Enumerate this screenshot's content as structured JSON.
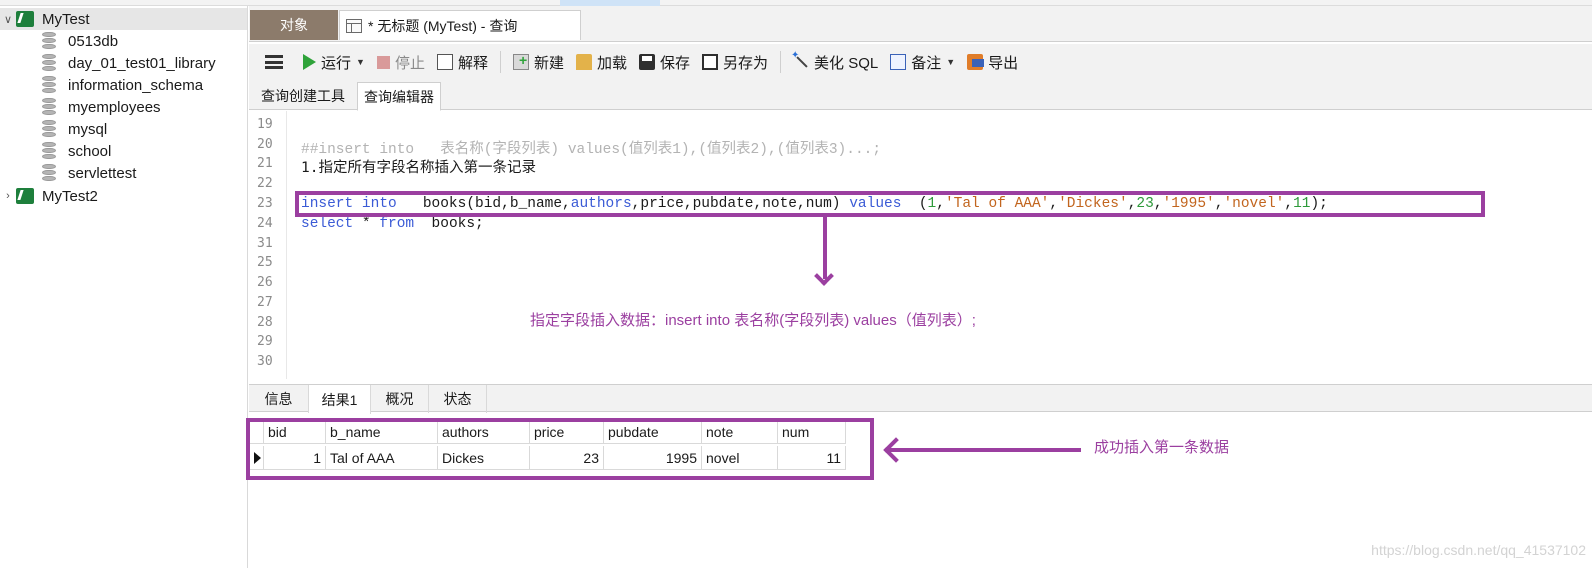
{
  "nav": {
    "connections": [
      {
        "name": "MyTest",
        "expanded": true,
        "databases": [
          "0513db",
          "day_01_test01_library",
          "information_schema",
          "myemployees",
          "mysql",
          "school",
          "servlettest"
        ]
      },
      {
        "name": "MyTest2",
        "expanded": false,
        "databases": []
      }
    ]
  },
  "tabs": {
    "objects": "对象",
    "query": "* 无标题 (MyTest) - 查询"
  },
  "toolbar": {
    "run": "运行",
    "stop": "停止",
    "explain": "解释",
    "new": "新建",
    "load": "加载",
    "save": "保存",
    "save_as": "另存为",
    "beautify": "美化 SQL",
    "note": "备注",
    "export": "导出"
  },
  "subtabs": {
    "builder": "查询创建工具",
    "editor": "查询编辑器"
  },
  "editor": {
    "line_numbers": [
      "19",
      "20",
      "21",
      "22",
      "23",
      "24",
      "25",
      "26",
      "27",
      "28",
      "29",
      "30",
      "31"
    ],
    "line20": "##insert into   表名称(字段列表) values(值列表1),(值列表2),(值列表3)...;",
    "line21": "1.指定所有字段名称插入第一条记录",
    "line23": {
      "kw1": "insert into",
      "p1": "   books(bid,b_name,",
      "kw2": "authors",
      "p2": ",price,pubdate,note,num) ",
      "kw3": "values",
      "p3": "  (",
      "n1": "1",
      "c1": ",",
      "s1": "'Tal of AAA'",
      "c2": ",",
      "s2": "'Dickes'",
      "c3": ",",
      "n2": "23",
      "c4": ",",
      "s3": "'1995'",
      "c5": ",",
      "s4": "'novel'",
      "c6": ",",
      "n3": "11",
      "end": ");"
    },
    "line24": {
      "kw1": "select",
      "p1": " * ",
      "kw2": "from",
      "p2": "  books;"
    }
  },
  "annotations": {
    "note1": "指定字段插入数据：insert into 表名称(字段列表)  values（值列表）;",
    "note2": "成功插入第一条数据",
    "color": "#9b3fa0"
  },
  "result_tabs": [
    "信息",
    "结果1",
    "概况",
    "状态"
  ],
  "grid": {
    "columns": [
      "bid",
      "b_name",
      "authors",
      "price",
      "pubdate",
      "note",
      "num"
    ],
    "rows": [
      [
        "1",
        "Tal of AAA",
        "Dickes",
        "23",
        "1995",
        "novel",
        "11"
      ]
    ]
  },
  "watermark": "https://blog.csdn.net/qq_41537102"
}
